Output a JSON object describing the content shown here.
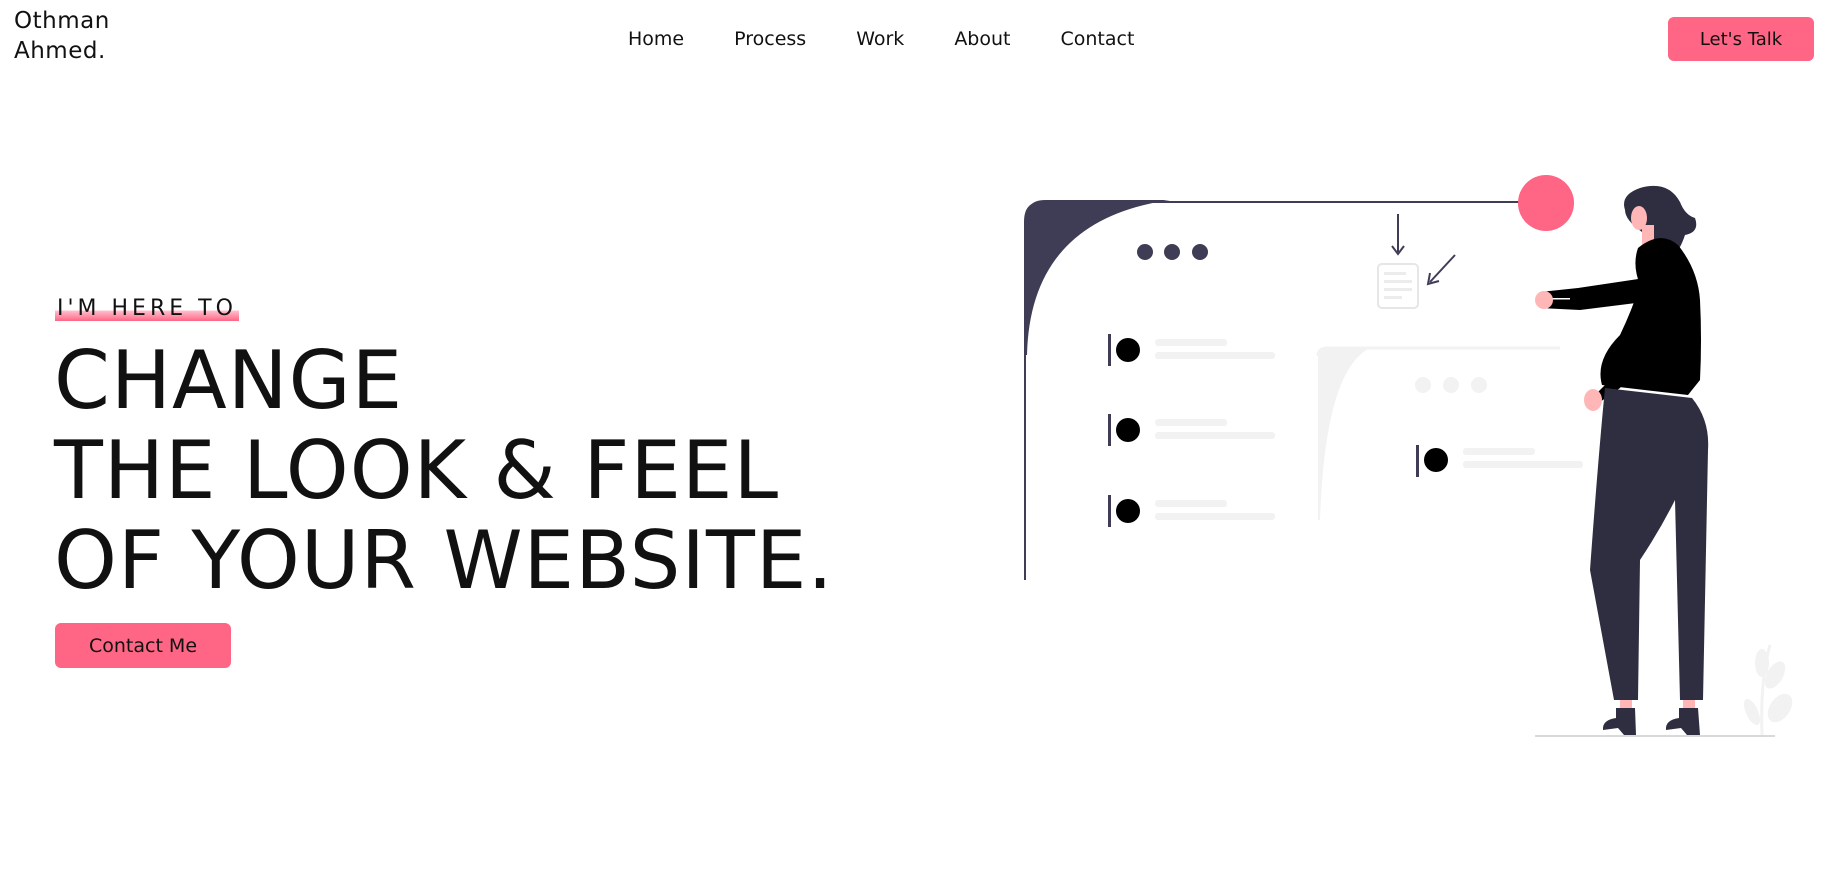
{
  "header": {
    "logo_line1": "Othman",
    "logo_line2": "Ahmed.",
    "nav": [
      {
        "label": "Home"
      },
      {
        "label": "Process"
      },
      {
        "label": "Work"
      },
      {
        "label": "About"
      },
      {
        "label": "Contact"
      }
    ],
    "cta_label": "Let's Talk"
  },
  "hero": {
    "kicker": "I'M HERE TO",
    "title_line1": "CHANGE",
    "title_line2": "THE LOOK & FEEL",
    "title_line3": "OF YOUR WEBSITE.",
    "button_label": "Contact Me"
  },
  "colors": {
    "accent": "#ff6584",
    "dark": "#3f3d56",
    "light_gray": "#f2f2f2"
  }
}
